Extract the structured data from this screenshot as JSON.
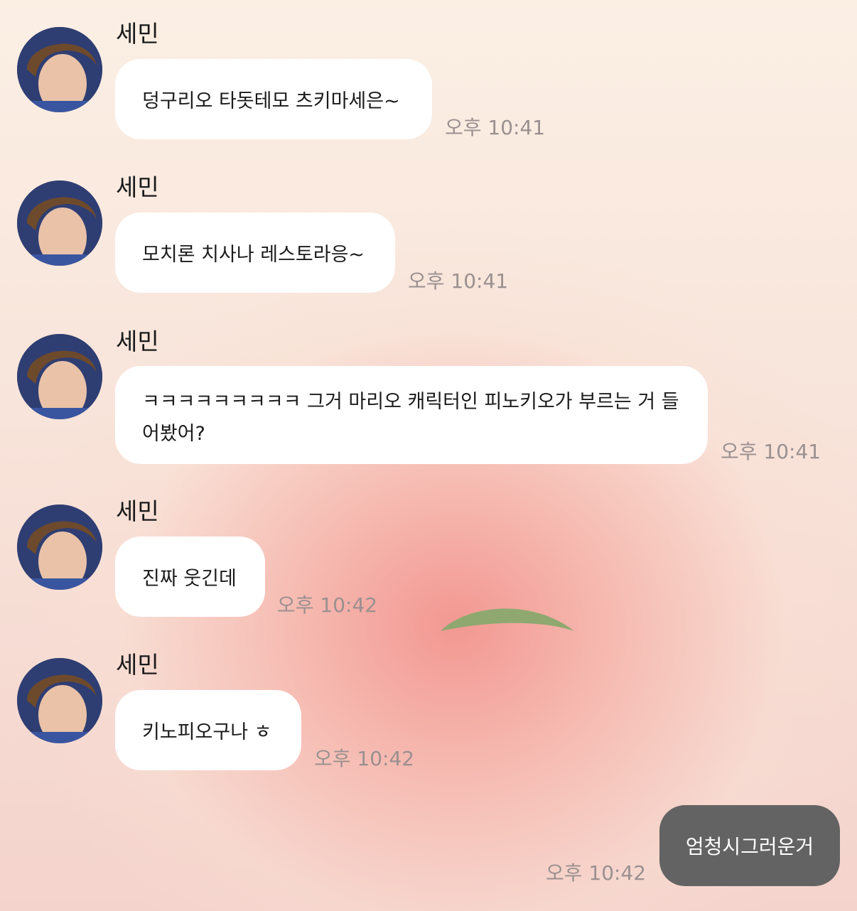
{
  "chat": {
    "sender": "세민",
    "messages": [
      {
        "text": "덩구리오 타돗테모 츠키마세은~",
        "time": "오후 10:41"
      },
      {
        "text": "모치론 치사나 레스토라응~",
        "time": "오후 10:41"
      },
      {
        "text": "ㅋㅋㅋㅋㅋㅋㅋㅋㅋ 그거 마리오 캐릭터인 피노키오가 부르는 거 들어봤어?",
        "time": "오후 10:41"
      },
      {
        "text": "진짜 웃긴데",
        "time": "오후 10:42"
      },
      {
        "text": "키노피오구나 ㅎ",
        "time": "오후 10:42"
      }
    ],
    "my_message": {
      "text": "엄청시그러운거",
      "time": "오후 10:42"
    }
  },
  "colors": {
    "incoming_bubble": "#ffffff",
    "outgoing_bubble": "#636363",
    "timestamp": "#9a9090"
  },
  "icons": {
    "wallpaper_decoration": "leaf-icon",
    "avatar": "profile-photo"
  }
}
